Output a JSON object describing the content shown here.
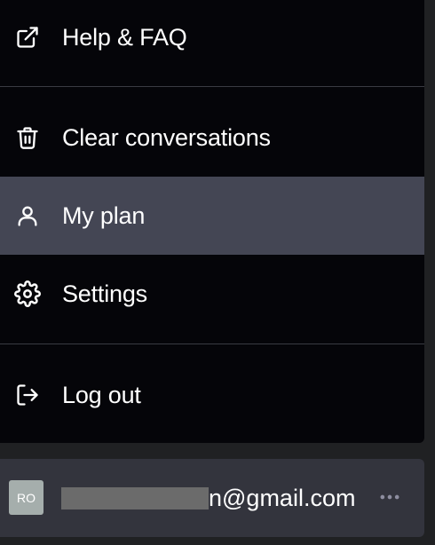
{
  "menu": {
    "items": [
      {
        "label": "Help & FAQ",
        "icon": "external-link-icon"
      },
      {
        "label": "Clear conversations",
        "icon": "trash-icon"
      },
      {
        "label": "My plan",
        "icon": "user-icon"
      },
      {
        "label": "Settings",
        "icon": "gear-icon"
      },
      {
        "label": "Log out",
        "icon": "logout-icon"
      }
    ]
  },
  "account": {
    "avatar_initials": "RO",
    "email_visible": "n@gmail.com",
    "more_icon": "more-horizontal-icon"
  },
  "colors": {
    "menu_bg": "#050509",
    "active_bg": "#444654",
    "account_bg": "#33343d",
    "avatar_bg": "#a5aeac",
    "text": "#ffffff"
  }
}
